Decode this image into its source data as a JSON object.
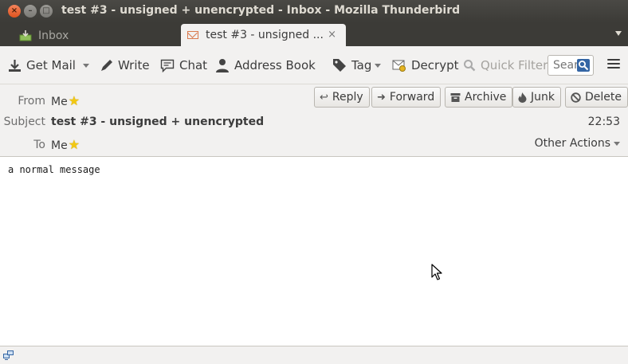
{
  "window": {
    "title": "test #3 - unsigned + unencrypted - Inbox - Mozilla Thunderbird",
    "controls": [
      "×",
      "–",
      "□"
    ]
  },
  "tabs": [
    {
      "label": "Inbox",
      "icon": "inbox-icon",
      "active": false
    },
    {
      "label": "test #3 - unsigned ...",
      "icon": "envelope-icon",
      "active": true,
      "close": "×"
    }
  ],
  "toolbar": {
    "get_mail": "Get Mail",
    "write": "Write",
    "chat": "Chat",
    "address_book": "Address Book",
    "tag": "Tag",
    "decrypt": "Decrypt",
    "quick_filter": "Quick Filter",
    "search_placeholder": "Search"
  },
  "header": {
    "from_label": "From",
    "from_value": "Me",
    "subject_label": "Subject",
    "subject_value": "test #3 - unsigned + unencrypted",
    "to_label": "To",
    "to_value": "Me",
    "time": "22:53",
    "other_actions": "Other Actions",
    "actions": {
      "reply": "Reply",
      "forward": "Forward",
      "archive": "Archive",
      "junk": "Junk",
      "delete": "Delete"
    }
  },
  "message": {
    "body": "a normal message"
  },
  "colors": {
    "title_bg": "#3c3b37",
    "panel_bg": "#f2f1f0",
    "close_button": "#e0531e",
    "star": "#f2c811"
  }
}
